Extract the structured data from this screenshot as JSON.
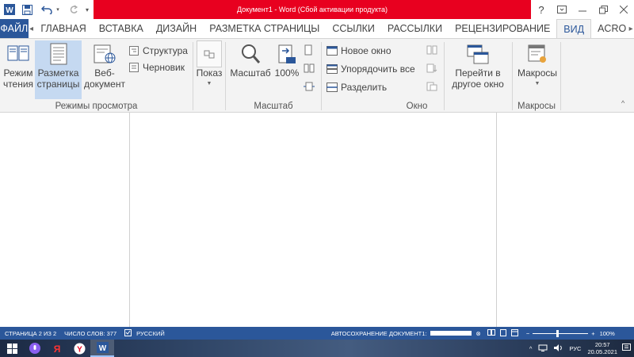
{
  "window": {
    "title": "Документ1 - Word (Сбой активации продукта)",
    "help_label": "?"
  },
  "tabs": {
    "file": "ФАЙЛ",
    "items": [
      {
        "label": "ГЛАВНАЯ"
      },
      {
        "label": "ВСТАВКА"
      },
      {
        "label": "ДИЗАЙН"
      },
      {
        "label": "РАЗМЕТКА СТРАНИЦЫ"
      },
      {
        "label": "ССЫЛКИ"
      },
      {
        "label": "РАССЫЛКИ"
      },
      {
        "label": "РЕЦЕНЗИРОВАНИЕ"
      },
      {
        "label": "ВИД",
        "active": true
      },
      {
        "label": "ACRO"
      }
    ]
  },
  "ribbon": {
    "views": {
      "group_label": "Режимы просмотра",
      "read_mode": [
        "Режим",
        "чтения"
      ],
      "print_layout": [
        "Разметка",
        "страницы"
      ],
      "web_layout": [
        "Веб-",
        "документ"
      ],
      "outline": "Структура",
      "draft": "Черновик"
    },
    "show": {
      "label": "Показ"
    },
    "zoom": {
      "group_label": "Масштаб",
      "zoom": "Масштаб",
      "percent": "100%"
    },
    "window": {
      "group_label": "Окно",
      "new_window": "Новое окно",
      "arrange_all": "Упорядочить все",
      "split": "Разделить",
      "switch": [
        "Перейти в",
        "другое окно"
      ]
    },
    "macros": {
      "group_label": "Макросы",
      "macros": "Макросы"
    }
  },
  "statusbar": {
    "page": "СТРАНИЦА 2 ИЗ 2",
    "words": "ЧИСЛО СЛОВ: 377",
    "language": "РУССКИЙ",
    "autosave": "АВТОСОХРАНЕНИЕ ДОКУМЕНТ1:",
    "zoom": "100%"
  },
  "taskbar": {
    "language": "РУС",
    "time": "20:57",
    "date": "20.05.2021"
  },
  "colors": {
    "accent": "#2b579a",
    "title_red": "#e8001f"
  }
}
